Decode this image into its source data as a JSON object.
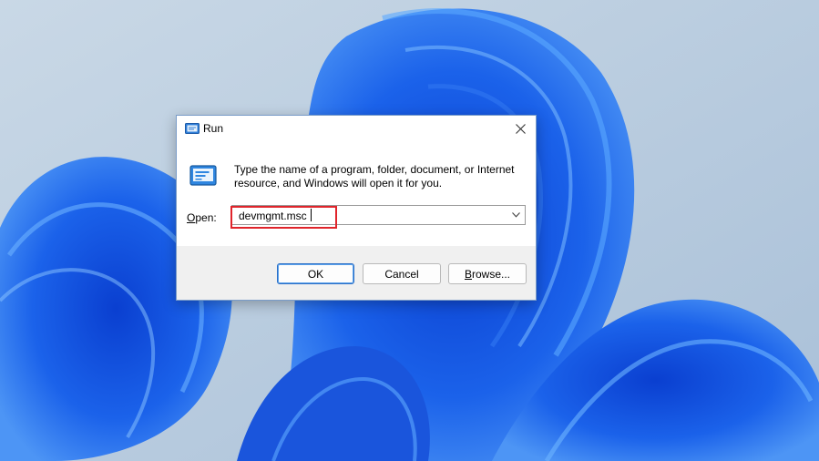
{
  "dialog": {
    "title": "Run",
    "description": "Type the name of a program, folder, document, or Internet resource, and Windows will open it for you.",
    "open_label_prefix": "O",
    "open_label_rest": "pen:",
    "open_value": "devmgmt.msc",
    "ok_label": "OK",
    "cancel_label": "Cancel",
    "browse_label_prefix": "B",
    "browse_label_rest": "rowse..."
  },
  "colors": {
    "accent": "#2b6fc7",
    "highlight_box": "#e0242b",
    "wallpaper_bg": "#b9cde0",
    "wallpaper_bloom": "#1f5fe0"
  },
  "icons": {
    "title": "run-app-icon",
    "large": "run-app-icon",
    "close": "close-icon",
    "dropdown": "chevron-down-icon"
  }
}
